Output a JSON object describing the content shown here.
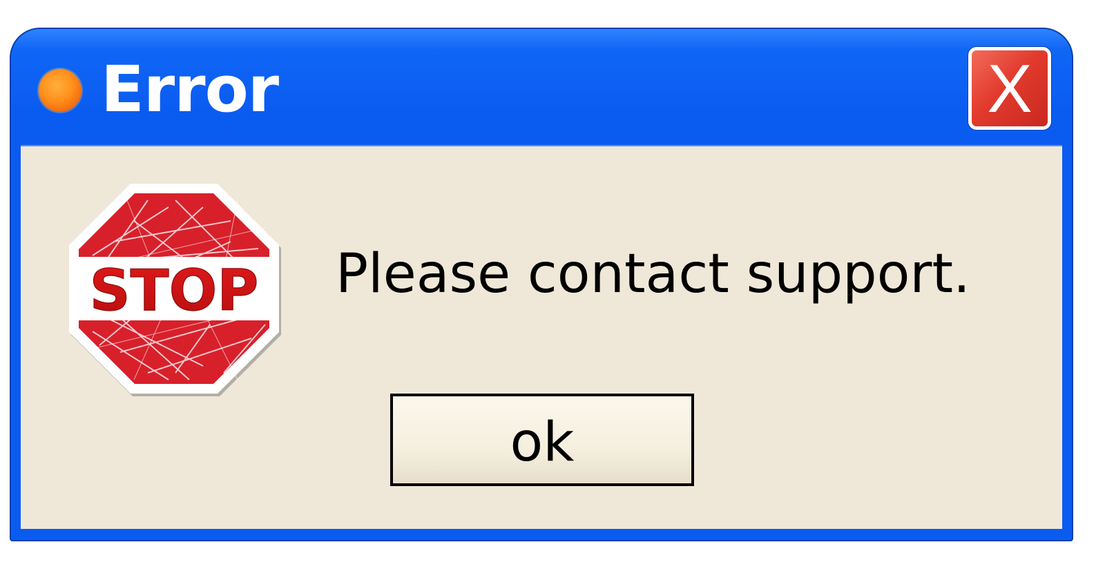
{
  "window": {
    "title": "Error",
    "title_dot_icon": "orange-circle-icon",
    "close_icon": "close-x-icon",
    "close_glyph": "X",
    "colors": {
      "titlebar": "#0a5cf0",
      "client_background": "#efe8d8",
      "close_button": "#e23b2e"
    }
  },
  "dialog": {
    "stop_icon": "stop-sign-icon",
    "stop_text": "STOP",
    "message": "Please contact support.",
    "ok_label": "ok"
  }
}
